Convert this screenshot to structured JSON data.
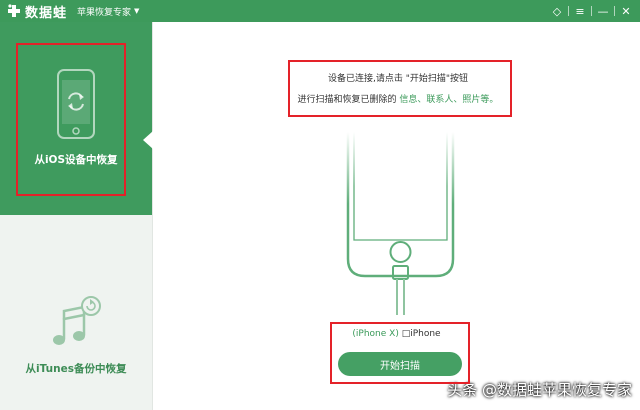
{
  "app": {
    "name": "数据蛙",
    "subtitle": "苹果恢复专家",
    "colors": {
      "brand": "#3d9a5b",
      "highlight": "#3b9a5a",
      "annotation": "#e42229"
    }
  },
  "window_controls": [
    {
      "name": "diamond-icon",
      "glyph": "◇"
    },
    {
      "name": "menu-icon",
      "glyph": "≡"
    },
    {
      "name": "minimize-icon",
      "glyph": "—"
    },
    {
      "name": "close-icon",
      "glyph": "✕"
    }
  ],
  "sidebar": {
    "items": [
      {
        "label": "从iOS设备中恢复",
        "icon": "phone-restore-icon",
        "active": true
      },
      {
        "label": "从iTunes备份中恢复",
        "icon": "music-note-restore-icon",
        "active": false
      }
    ]
  },
  "main": {
    "message_line1": "设备已连接,请点击 \"开始扫描\"按钮",
    "message_line2_prefix": "进行扫描和恢复已删除的 ",
    "message_highlight": "信息、联系人、照片等。",
    "device_model": "(iPhone X)",
    "device_name": " □iPhone",
    "start_button": "开始扫描"
  },
  "watermark": "头条 @数据蛙苹果恢复专家"
}
